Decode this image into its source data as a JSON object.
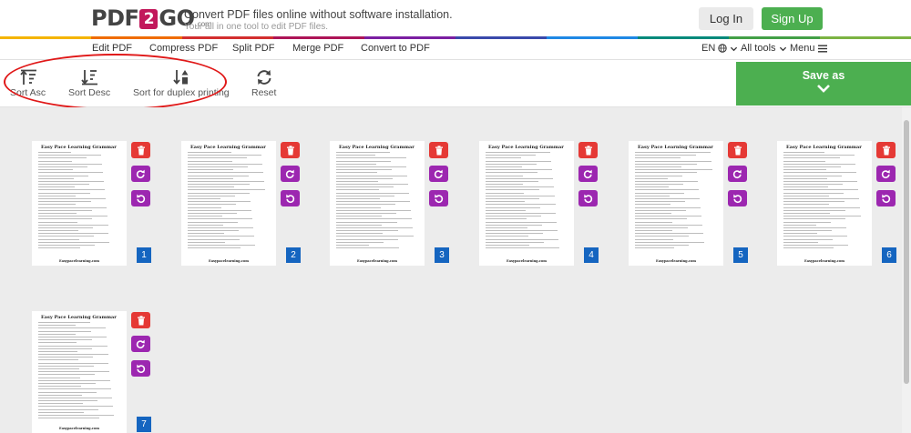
{
  "brand": {
    "part1": "PDF",
    "part2": "2",
    "part3": "GO",
    "suffix": ".com"
  },
  "header": {
    "tagline": "Convert PDF files online without software installation.",
    "subtagline": "Your all in one tool to edit PDF files.",
    "login_label": "Log In",
    "signup_label": "Sign Up"
  },
  "colors": {
    "accent_green": "#4caf50",
    "delete_red": "#e53935",
    "rotate_purple": "#9c27b0",
    "page_number_blue": "#1565c0",
    "highlight_ellipse": "#e01818",
    "logo_magenta": "#c2185b"
  },
  "nav": {
    "items": [
      "Edit PDF",
      "Compress PDF",
      "Split PDF",
      "Merge PDF",
      "Convert to PDF"
    ],
    "language": "EN",
    "all_tools": "All tools",
    "menu": "Menu"
  },
  "toolbar": {
    "sort_asc": "Sort Asc",
    "sort_desc": "Sort Desc",
    "sort_duplex": "Sort for duplex printing",
    "reset": "Reset",
    "save_as": "Save as"
  },
  "pages": [
    {
      "number": "1",
      "title": "Easy Pace Learning Grammar",
      "footer": "Easypacelearning.com"
    },
    {
      "number": "2",
      "title": "Easy Pace Learning Grammar",
      "footer": "Easypacelearning.com"
    },
    {
      "number": "3",
      "title": "Easy Pace Learning Grammar",
      "footer": "Easypacelearning.com"
    },
    {
      "number": "4",
      "title": "Easy Pace Learning Grammar",
      "footer": "Easypacelearning.com"
    },
    {
      "number": "5",
      "title": "Easy Pace Learning Grammar",
      "footer": "Easypacelearning.com"
    },
    {
      "number": "6",
      "title": "Easy Pace Learning Grammar",
      "footer": "Easypacelearning.com"
    },
    {
      "number": "7",
      "title": "Easy Pace Learning Grammar",
      "footer": "Easypacelearning.com"
    }
  ],
  "page_actions": {
    "delete_icon": "trash-icon",
    "rotate_cw_icon": "rotate-clockwise-icon",
    "rotate_ccw_icon": "rotate-counterclockwise-icon"
  }
}
